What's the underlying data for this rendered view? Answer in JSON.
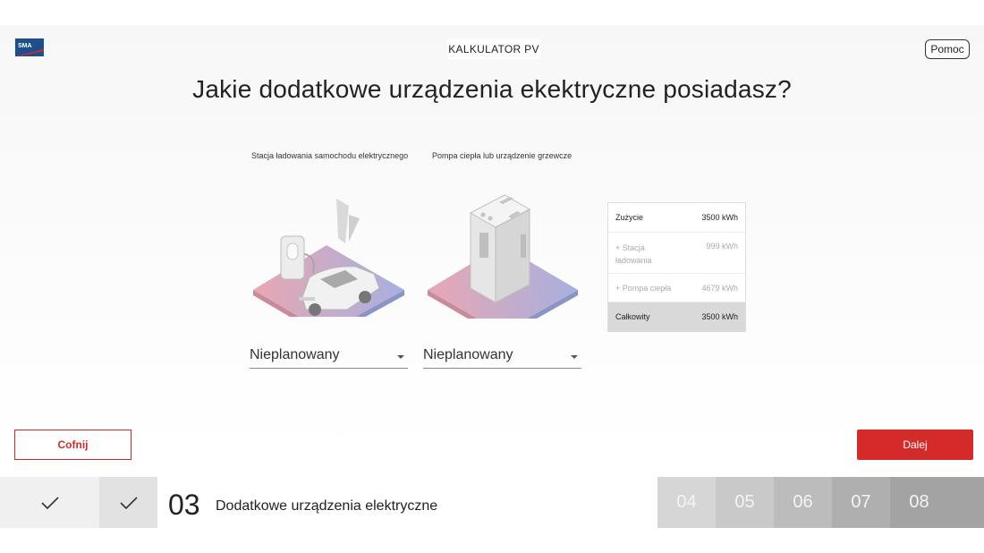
{
  "header": {
    "logo_text": "SMA",
    "app_title": "KALKULATOR PV",
    "help_label": "Pomoc"
  },
  "question": "Jakie dodatkowe urządzenia ekektryczne posiadasz?",
  "devices": [
    {
      "label": "Stacja ładowania samochodu elektrycznego",
      "selected": "Nieplanowany",
      "icon": "ev-charging-station-illustration"
    },
    {
      "label": "Pompa ciepła lub urządzenie grzewcze",
      "selected": "Nieplanowany",
      "icon": "heat-pump-illustration"
    }
  ],
  "summary": {
    "consumption_label": "Zużycie",
    "consumption_value": "3500 kWh",
    "charging_label": "+ Stacja ładowania",
    "charging_value": "999 kWh",
    "heatpump_label": "+ Pompa ciepła",
    "heatpump_value": "4679 kWh",
    "total_label": "Całkowity",
    "total_value": "3500 kWh"
  },
  "nav": {
    "back_label": "Cofnij",
    "next_label": "Dalej"
  },
  "steps": {
    "completed_icon": "checkmark-icon",
    "current_number": "03",
    "current_label": "Dodatkowe urządzenia elektryczne",
    "future": [
      "04",
      "05",
      "06",
      "07",
      "08"
    ]
  },
  "colors": {
    "accent": "#d42a2a",
    "brand_blue": "#1f4e8c"
  }
}
